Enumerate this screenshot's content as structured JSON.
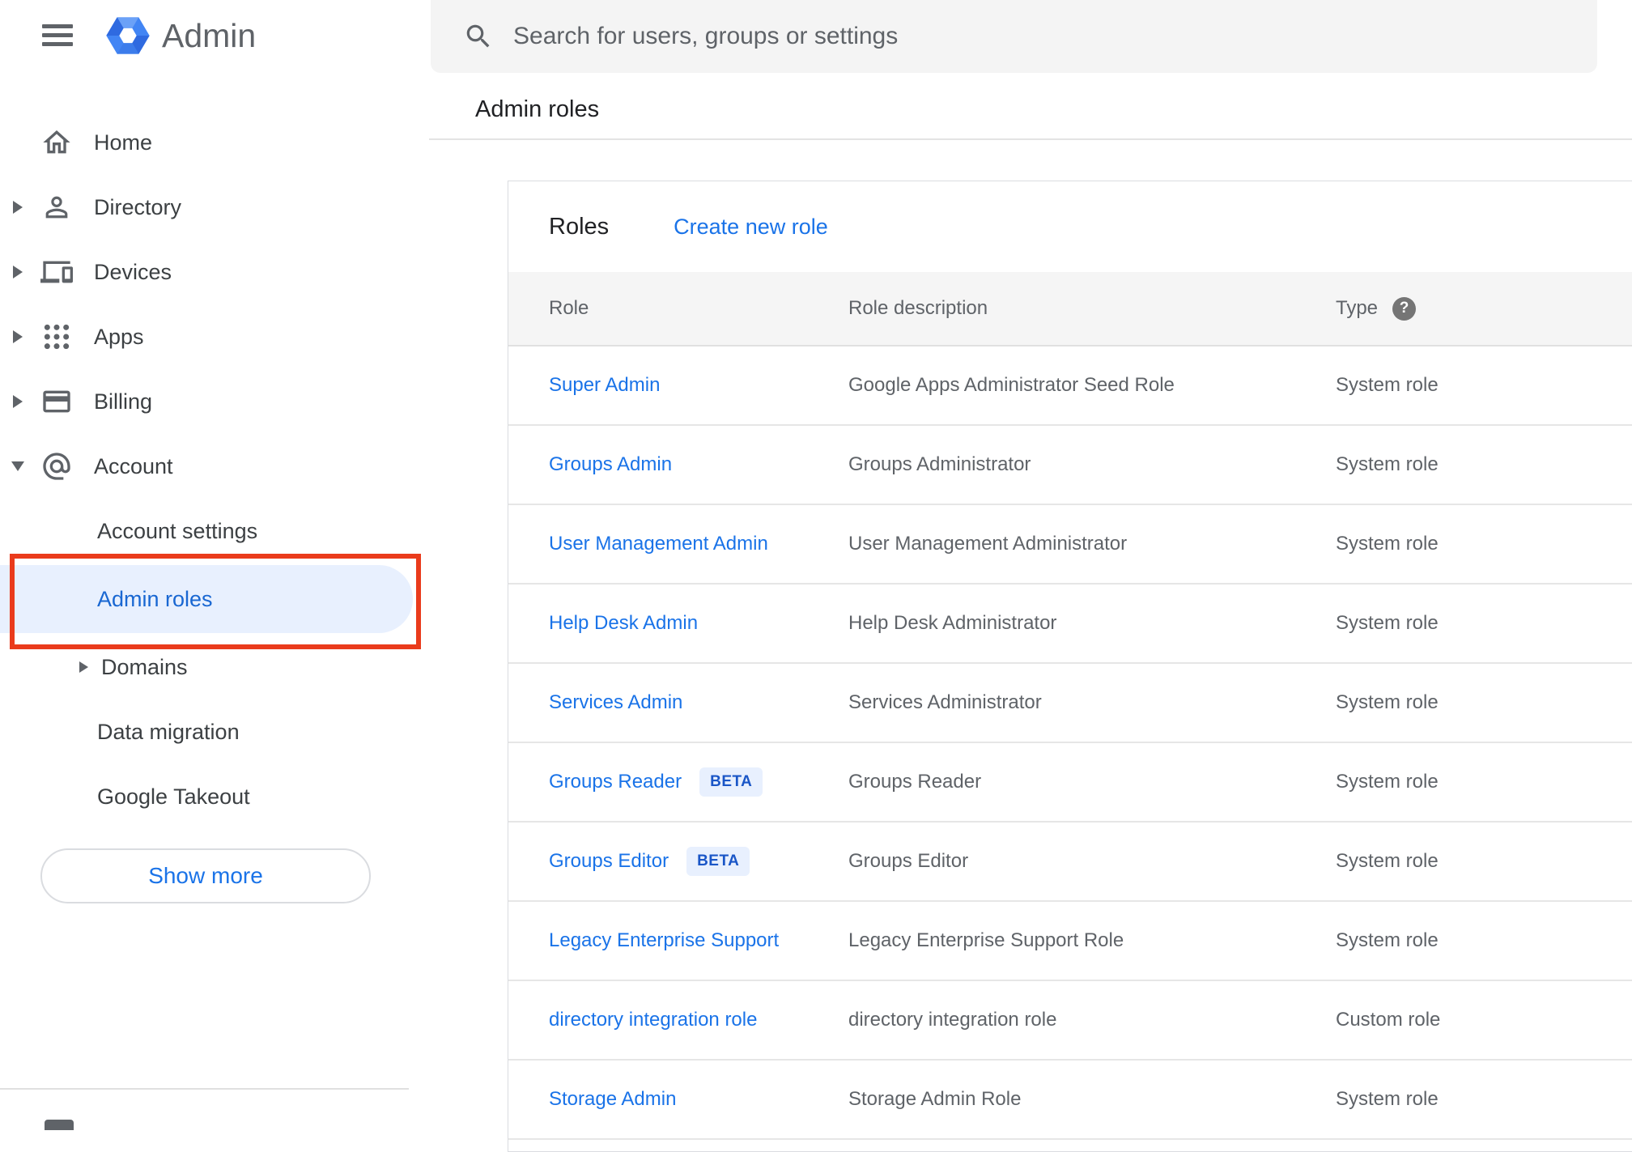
{
  "brand": {
    "app_name": "Admin",
    "menu_icon": "hamburger-menu-icon",
    "logo_icon": "admin-hexagon-logo"
  },
  "search": {
    "placeholder": "Search for users, groups or settings",
    "icon": "search-icon"
  },
  "breadcrumb": "Admin roles",
  "sidebar": {
    "items": [
      {
        "label": "Home",
        "icon": "home-icon",
        "expander": "none"
      },
      {
        "label": "Directory",
        "icon": "person-icon",
        "expander": "right"
      },
      {
        "label": "Devices",
        "icon": "devices-icon",
        "expander": "right"
      },
      {
        "label": "Apps",
        "icon": "apps-grid-icon",
        "expander": "right"
      },
      {
        "label": "Billing",
        "icon": "credit-card-icon",
        "expander": "right"
      },
      {
        "label": "Account",
        "icon": "at-sign-icon",
        "expander": "down"
      },
      {
        "label": "Account settings",
        "sub": true
      },
      {
        "label": "Admin roles",
        "sub": true,
        "active": true,
        "annotated_with_red_box": true
      },
      {
        "label": "Domains",
        "sub": true,
        "expander": "right"
      },
      {
        "label": "Data migration",
        "sub": true
      },
      {
        "label": "Google Takeout",
        "sub": true
      }
    ],
    "show_more_label": "Show more"
  },
  "main": {
    "title": "Roles",
    "create_link": "Create new role",
    "table": {
      "headers": {
        "role": "Role",
        "description": "Role description",
        "type": "Type"
      },
      "type_help_glyph": "?",
      "rows": [
        {
          "role": "Super Admin",
          "description": "Google Apps Administrator Seed Role",
          "type": "System role"
        },
        {
          "role": "Groups Admin",
          "description": "Groups Administrator",
          "type": "System role"
        },
        {
          "role": "User Management Admin",
          "description": "User Management Administrator",
          "type": "System role"
        },
        {
          "role": "Help Desk Admin",
          "description": "Help Desk Administrator",
          "type": "System role"
        },
        {
          "role": "Services Admin",
          "description": "Services Administrator",
          "type": "System role"
        },
        {
          "role": "Groups Reader",
          "badge": "BETA",
          "description": "Groups Reader",
          "type": "System role"
        },
        {
          "role": "Groups Editor",
          "badge": "BETA",
          "description": "Groups Editor",
          "type": "System role"
        },
        {
          "role": "Legacy Enterprise Support",
          "description": "Legacy Enterprise Support Role",
          "type": "System role"
        },
        {
          "role": "directory integration role",
          "description": "directory integration role",
          "type": "Custom role"
        },
        {
          "role": "Storage Admin",
          "description": "Storage Admin Role",
          "type": "System role"
        }
      ]
    }
  },
  "colors": {
    "link_blue": "#1a73e8",
    "active_item_blue": "#1967d2",
    "active_item_bg": "#e8f0fe",
    "annotation_red": "#ea3b1c",
    "beta_badge_bg": "#e8f0fe",
    "beta_badge_text": "#1a56c7",
    "search_bg": "#f4f4f4",
    "table_header_bg": "#f5f5f5",
    "icon_gray": "#5f6368",
    "logo_blue": "#4285f4"
  }
}
